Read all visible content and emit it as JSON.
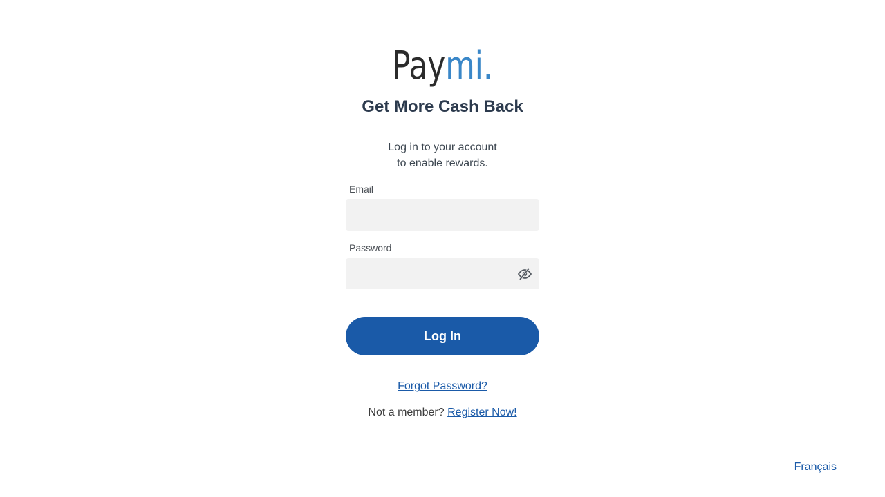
{
  "brand": {
    "logo_part1": "Pay",
    "logo_part2": "mi.",
    "logo_color_dark": "#2b2b2b",
    "logo_color_accent": "#3a87c8"
  },
  "header": {
    "tagline": "Get More Cash Back",
    "intro_line1": "Log in to your account",
    "intro_line2": "to enable rewards."
  },
  "form": {
    "email_label": "Email",
    "email_value": "",
    "password_label": "Password",
    "password_value": "",
    "password_toggle_icon": "eye-slash-icon",
    "login_label": "Log In"
  },
  "links": {
    "forgot_password": "Forgot Password?",
    "not_member_text": "Not a member?",
    "register": "Register Now!",
    "language": "Français"
  },
  "colors": {
    "primary": "#1a5aa8",
    "input_bg": "#f2f2f2",
    "heading": "#2c3a4d"
  }
}
